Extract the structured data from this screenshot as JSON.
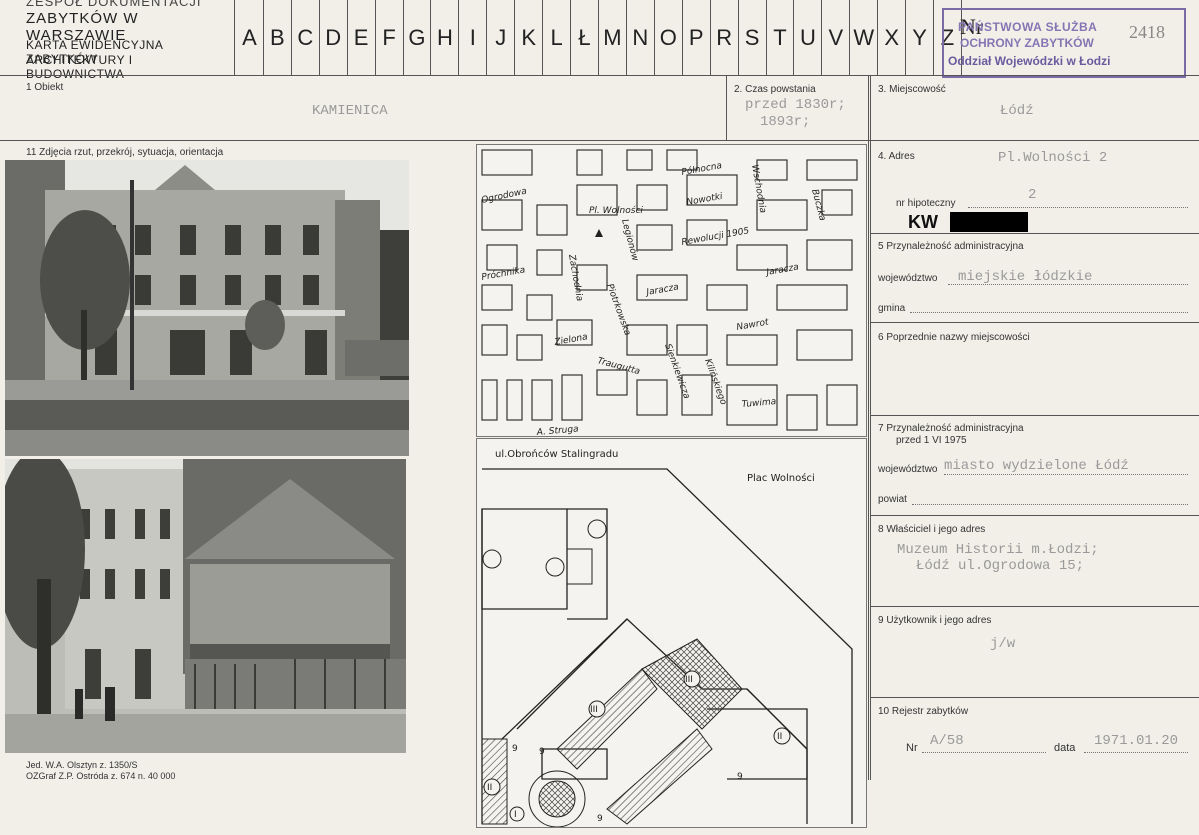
{
  "header": {
    "line1": "ZESPÓŁ DOKUMENTACJI",
    "line2": "ZABYTKÓW W WARSZAWIE",
    "line3": "KARTA EWIDENCYJNA ZABYTKÓW",
    "line4": "ARCHITEKTURY I BUDOWNICTWA",
    "letters": [
      "A",
      "B",
      "C",
      "D",
      "E",
      "F",
      "G",
      "H",
      "I",
      "J",
      "K",
      "L",
      "Ł",
      "M",
      "N",
      "O",
      "P",
      "R",
      "S",
      "T",
      "U",
      "V",
      "W",
      "X",
      "Y",
      "Z"
    ]
  },
  "stamp": {
    "nr_label": "Nr",
    "number": "2418",
    "line1": "PAŃSTWOWA SŁUŻBA",
    "line2": "OCHRONY ZABYTKÓW",
    "line3": "Oddział Wojewódzki w Łodzi"
  },
  "fields": {
    "obiekt_label": "1  Obiekt",
    "obiekt_value": "KAMIENICA",
    "czas_label": "2. Czas powstania",
    "czas_value1": "przed 1830r;",
    "czas_value2": "1893r;",
    "miejscowosc_label": "3. Miejscowość",
    "miejscowosc_value": "Łódź",
    "zdjecia_label": "11  Zdjęcia  rzut,  przekrój,  sytuacja,  orientacja",
    "adres_label": "4. Adres",
    "adres_value": "Pl.Wolności 2",
    "hipoteczny_label": "nr hipoteczny",
    "hipoteczny_value": "2",
    "kw_label": "KW",
    "przynaleznosc_label": "5  Przynależność administracyjna",
    "wojewodztwo_label": "województwo",
    "wojewodztwo_value": "miejskie łódzkie",
    "gmina_label": "gmina",
    "poprzednie_label": "6  Poprzednie nazwy miejscowości",
    "przynaleznosc75_label": "7  Przynależność administracyjna",
    "przynaleznosc75_sub": "przed 1 VI 1975",
    "wojewodztwo75_label": "województwo",
    "wojewodztwo75_value": "miasto wydzielone Łódź",
    "powiat_label": "powiat",
    "wlasciciel_label": "8  Właściciel i jego adres",
    "wlasciciel_value1": "Muzeum Historii m.Łodzi;",
    "wlasciciel_value2": "Łódź ul.Ogrodowa 15;",
    "uzytkownik_label": "9  Użytkownik i jego adres",
    "uzytkownik_value": "j/w",
    "rejestr_label": "10  Rejestr zabytków",
    "rejestr_nr_label": "Nr",
    "rejestr_nr_value": "A/58",
    "rejestr_data_label": "data",
    "rejestr_data_value": "1971.01.20"
  },
  "map": {
    "streets": [
      "Ogrodowa",
      "Północna",
      "Zachodnia",
      "Pl. Wolności",
      "Nowotki",
      "Rewolucji 1905",
      "Próchnika",
      "Piotrkowska",
      "Legionów",
      "Jaracza",
      "Nawrot",
      "Zielona",
      "Traugutta",
      "Sienkiewicza",
      "Kilińskiego",
      "Tuwima",
      "A. Struga",
      "Wschodnia",
      "Buczka",
      "Jaracza"
    ],
    "plan_street": "ul.Obrońców Stalingradu",
    "plan_square": "Plac Wolności",
    "plan_marks": [
      "III",
      "III",
      "II",
      "II",
      "I",
      "9",
      "9",
      "9",
      "9"
    ]
  },
  "footer": {
    "line1": "Jed. W.A. Olsztyn  z. 1350/S",
    "line2": "OZGraf  Z.P. Ostróda z. 674 n. 40 000"
  }
}
